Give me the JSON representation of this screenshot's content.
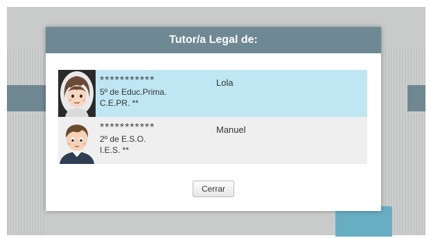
{
  "modal": {
    "title": "Tutor/a Legal de:",
    "close_label": "Cerrar"
  },
  "children": [
    {
      "masked_name": "***********",
      "first_name": "Lola",
      "course": "5º de Educ.Prima.",
      "school": "C.E.PR. **",
      "avatar_icon": "girl-avatar-icon"
    },
    {
      "masked_name": "***********",
      "first_name": "Manuel",
      "course": "2º de E.S.O.",
      "school": "I.E.S.  **",
      "avatar_icon": "boy-avatar-icon"
    }
  ],
  "colors": {
    "header": "#6e8894",
    "selected_row": "#bfe7f3",
    "row": "#efefef"
  }
}
